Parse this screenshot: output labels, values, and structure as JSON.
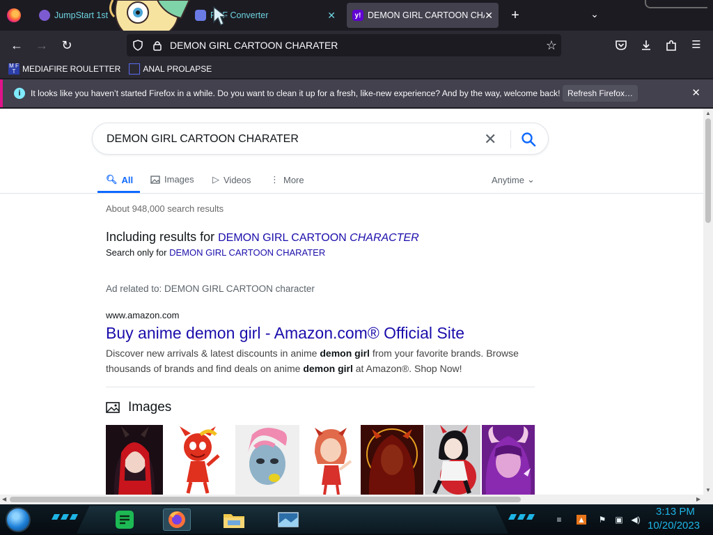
{
  "browser": {
    "tabs": [
      {
        "title": "JumpStart 1st",
        "active": false
      },
      {
        "title": "PDF Converter",
        "active": false
      },
      {
        "title": "DEMON GIRL CARTOON CHARATER",
        "active": true
      }
    ],
    "url": "DEMON GIRL CARTOON CHARATER",
    "bookmarks": [
      {
        "label": "MEDIAFIRE ROULETTER",
        "icon": "mediafire-icon"
      },
      {
        "label": "ANAL PROLAPSE",
        "icon": "bookmark-icon"
      }
    ],
    "notification": {
      "message": "It looks like you haven’t started Firefox in a while. Do you want to clean it up for a fresh, like-new experience? And by the way, welcome back!",
      "button": "Refresh Firefox…"
    }
  },
  "search": {
    "query": "DEMON GIRL CARTOON CHARATER",
    "tabs": {
      "all": "All",
      "images": "Images",
      "videos": "Videos",
      "more": "More",
      "anytime": "Anytime"
    },
    "result_count": "About 948,000 search results",
    "including_prefix": "Including results for",
    "corrected_plain": "DEMON GIRL CARTOON",
    "corrected_italic": "CHARACTER",
    "search_only_prefix": "Search only for",
    "search_only_link": "DEMON GIRL CARTOON CHARATER",
    "ad": {
      "label": "Ad related to: DEMON GIRL CARTOON character",
      "domain": "www.amazon.com",
      "title": "Buy anime demon girl - Amazon.com® Official Site",
      "desc_1": "Discover new arrivals & latest discounts in anime",
      "desc_bold_1": "demon girl",
      "desc_2": "from your favorite brands. Browse thousands of brands and find deals on anime",
      "desc_bold_2": "demon girl",
      "desc_3": "at Amazon®. Shop Now!"
    },
    "images_heading": "Images"
  },
  "taskbar": {
    "time": "3:13 PM",
    "date": "10/20/2023"
  },
  "colors": {
    "link": "#1a0dab",
    "accent_blue": "#0f69ff",
    "notification_stripe": "#e0138a",
    "clock": "#1eb5e6"
  }
}
